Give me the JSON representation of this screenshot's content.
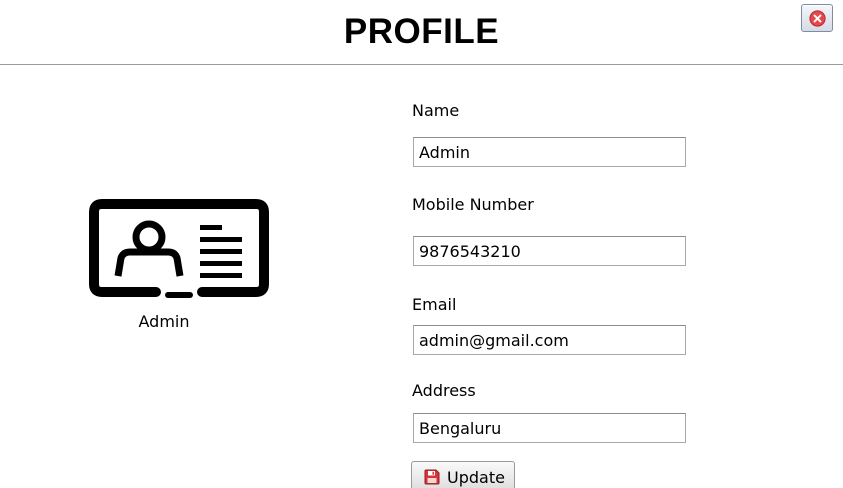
{
  "header": {
    "title": "PROFILE"
  },
  "window": {
    "close_icon": "close-icon"
  },
  "profile": {
    "icon": "id-card-icon",
    "caption": "Admin"
  },
  "form": {
    "name": {
      "label": "Name",
      "value": "Admin"
    },
    "mobile": {
      "label": "Mobile Number",
      "value": "9876543210"
    },
    "email": {
      "label": "Email",
      "value": "admin@gmail.com"
    },
    "address": {
      "label": "Address",
      "value": "Bengaluru"
    }
  },
  "actions": {
    "update_label": "Update",
    "update_icon": "floppy-disk-icon"
  },
  "colors": {
    "close_icon": "#e5484d",
    "save_icon": "#d8343b"
  }
}
